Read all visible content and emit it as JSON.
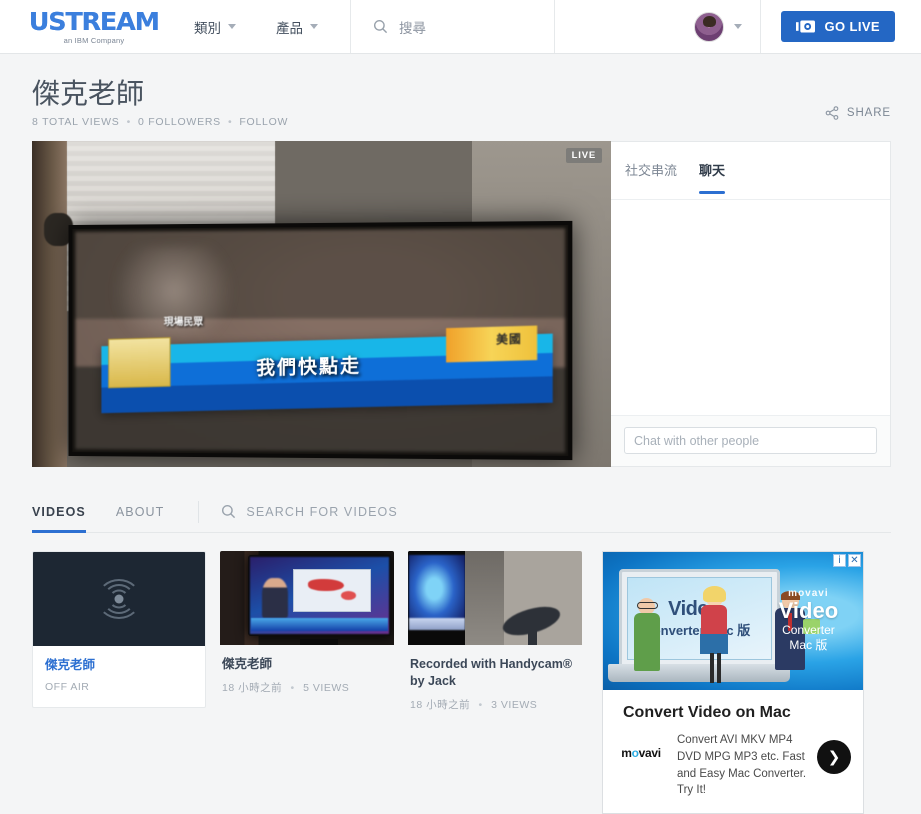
{
  "header": {
    "logo": "USTREAM",
    "logo_sub": "an IBM Company",
    "nav": [
      {
        "label": "類別",
        "name": "nav-categories"
      },
      {
        "label": "產品",
        "name": "nav-products"
      }
    ],
    "search_placeholder": "搜尋",
    "search_icon": "search-icon",
    "go_live_label": "GO LIVE",
    "go_live_icon": "camera-icon",
    "avatar_icon": "user-avatar",
    "account_caret_icon": "chevron-down-icon"
  },
  "channel": {
    "title": "傑克老師",
    "views": "8 TOTAL VIEWS",
    "followers": "0 FOLLOWERS",
    "follow": "FOLLOW",
    "dot": "•",
    "share_label": "SHARE",
    "share_icon": "share-icon"
  },
  "player": {
    "live_badge": "LIVE",
    "scene_texts": {
      "ticker": "我們快點走",
      "lower_tag": "現場民眾",
      "corner_tag": "美國"
    }
  },
  "chat": {
    "tabs": [
      {
        "label": "社交串流",
        "active": false
      },
      {
        "label": "聊天",
        "active": true
      }
    ],
    "input_placeholder": "Chat with other people"
  },
  "videos_section": {
    "tabs": [
      {
        "label": "VIDEOS",
        "active": true
      },
      {
        "label": "ABOUT",
        "active": false
      }
    ],
    "search_placeholder": "SEARCH FOR VIDEOS",
    "search_icon": "search-icon"
  },
  "cards": [
    {
      "title": "傑克老師",
      "status": "OFF AIR",
      "thumb": "offair-broadcast-icon",
      "is_live_link": true
    },
    {
      "title": "傑克老師",
      "time": "18 小時之前",
      "sep": "•",
      "views": "5 VIEWS",
      "thumb": "tv-weather-map"
    },
    {
      "title": "Recorded with Handycam® by Jack",
      "time": "18 小時之前",
      "sep": "•",
      "views": "3 VIEWS",
      "thumb": "tv-and-speaker"
    }
  ],
  "ad": {
    "adchoices_icon": "info-icon",
    "close_icon": "close-icon",
    "adchoices_label": "i",
    "close_label": "✕",
    "brand": "movavi",
    "product_line1": "Video",
    "product_line2": "Converter",
    "product_line3": "Mac 版",
    "screen_text1": "Video",
    "screen_text2": "Converter Mac 版",
    "headline": "Convert Video on Mac",
    "logo_left": "m",
    "logo_o": "o",
    "logo_right": "vavi",
    "description": "Convert AVI MKV MP4 DVD MPG MP3 etc. Fast and Easy Mac Converter. Try It!",
    "arrow_icon": "chevron-right-icon",
    "arrow_label": "❯"
  },
  "colors": {
    "brand_blue": "#3b7fdd",
    "accent_blue": "#2c6fd1",
    "go_live_blue": "#2467c4",
    "page_bg": "#f4f5f6",
    "text": "#3c4858",
    "muted": "#9aa3ad"
  }
}
